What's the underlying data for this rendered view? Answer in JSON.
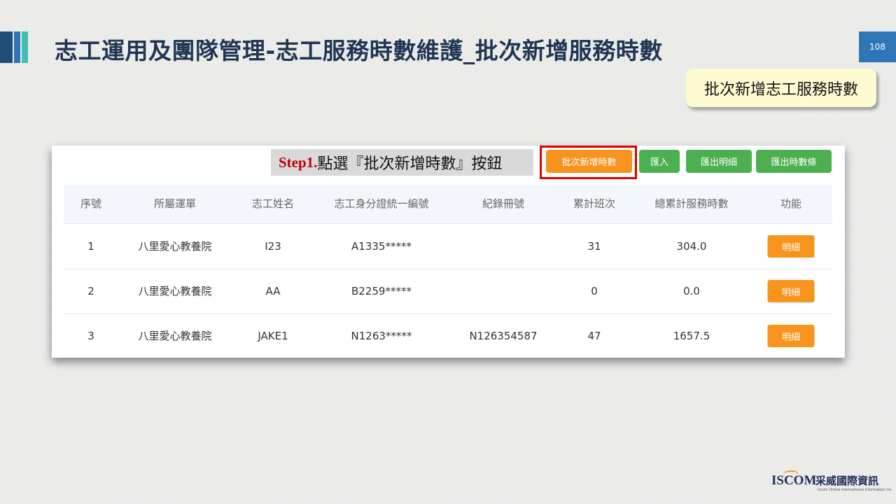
{
  "slide": {
    "title": "志工運用及團隊管理-志工服務時數維護_批次新增服務時數",
    "page_number": "108",
    "callout": "批次新增志工服務時數"
  },
  "step": {
    "number": "Step1.",
    "text": "點選『批次新增時數』按鈕"
  },
  "toolbar": {
    "batch_add_label": "批次新增時數",
    "import_label": "匯入",
    "export_detail_label": "匯出明細",
    "export_hours_label": "匯出時數條"
  },
  "table": {
    "headers": [
      "序號",
      "所屬運單",
      "志工姓名",
      "志工身分證統一編號",
      "紀錄冊號",
      "累計班次",
      "總累計服務時數",
      "功能"
    ],
    "rows": [
      {
        "no": "1",
        "unit": "八里愛心教養院",
        "name": "I23",
        "id": "A1335*****",
        "record": "",
        "shifts": "31",
        "hours": "304.0",
        "action": "明細"
      },
      {
        "no": "2",
        "unit": "八里愛心教養院",
        "name": "AA",
        "id": "B2259*****",
        "record": "",
        "shifts": "0",
        "hours": "0.0",
        "action": "明細"
      },
      {
        "no": "3",
        "unit": "八里愛心教養院",
        "name": "JAKE1",
        "id": "N1263*****",
        "record": "N126354587",
        "shifts": "47",
        "hours": "1657.5",
        "action": "明細"
      }
    ]
  },
  "logo": {
    "text": "ISCOM",
    "chinese": "采威國際資訊",
    "subtitle": "Iscom Online International Information Inc."
  },
  "colors": {
    "accent_orange": "#f7941d",
    "accent_green": "#4caf50",
    "title_navy": "#1f3552",
    "highlight_red": "#e00000"
  }
}
